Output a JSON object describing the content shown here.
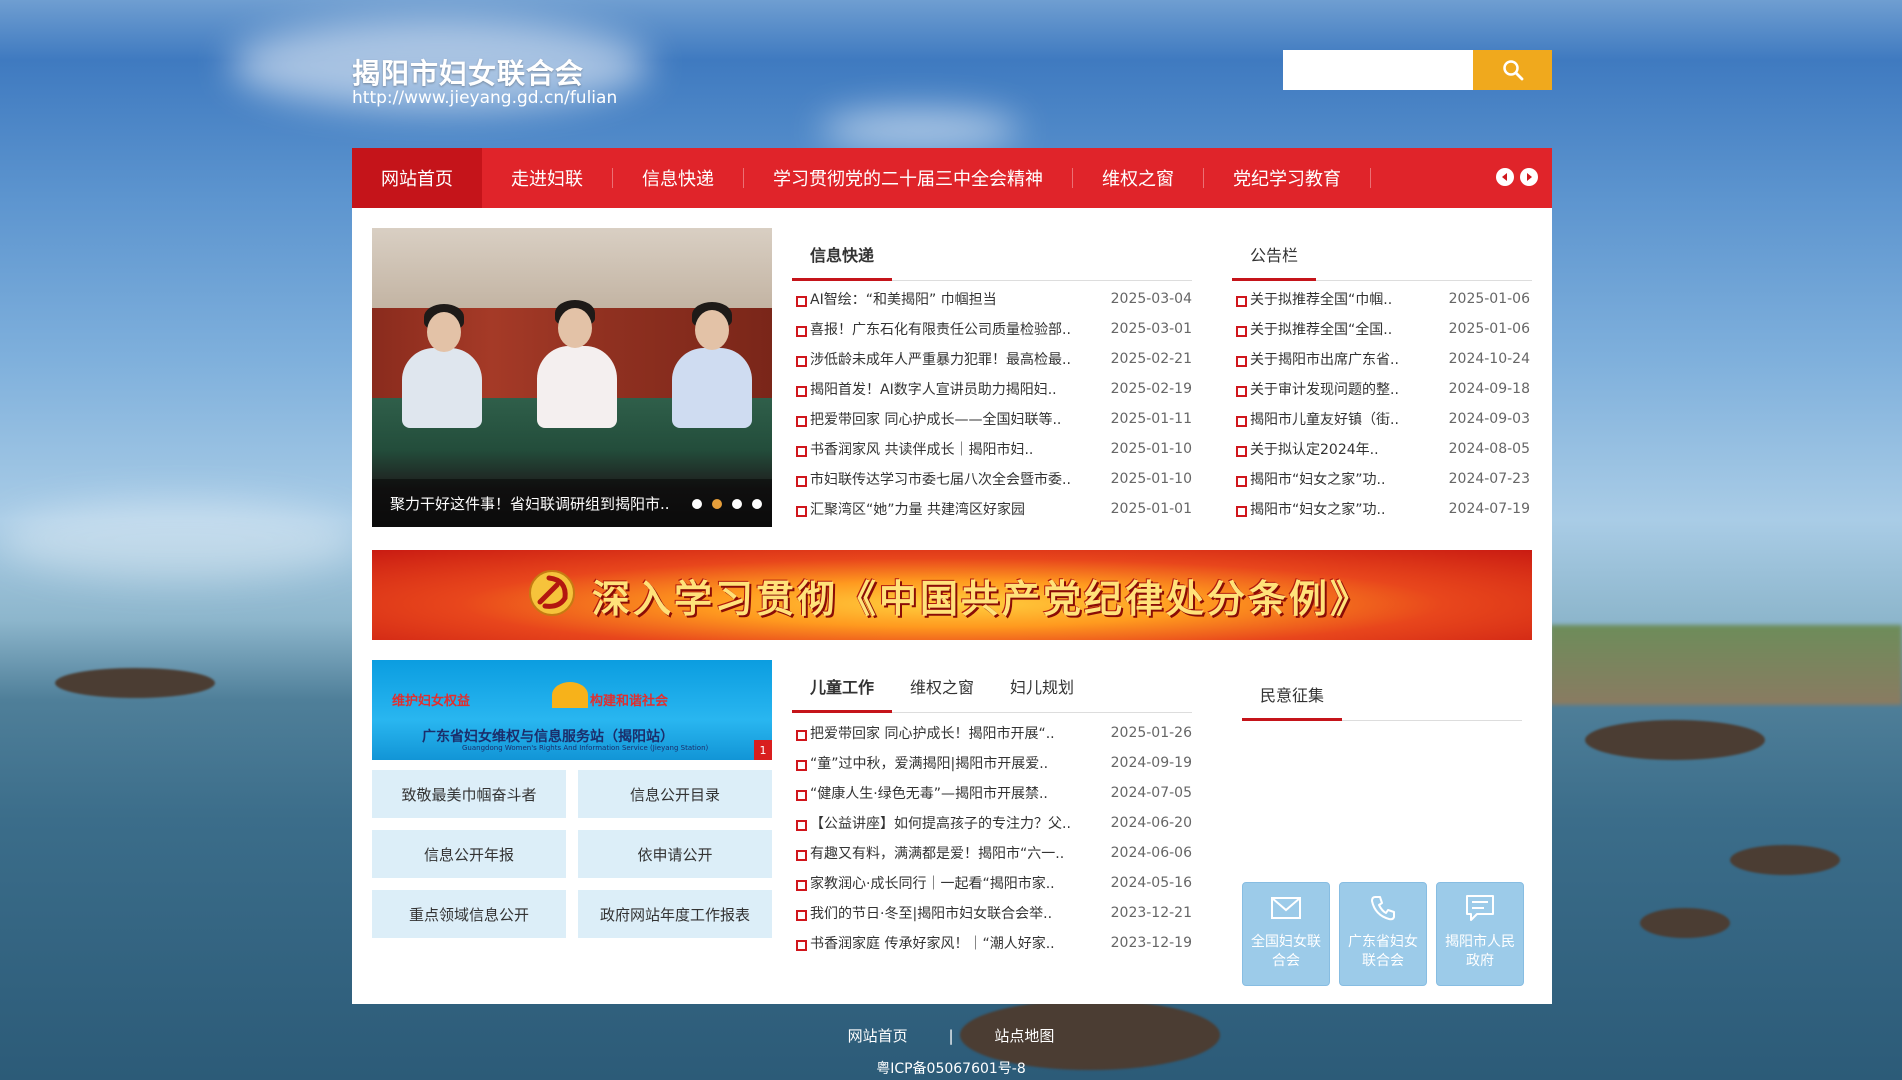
{
  "header": {
    "title": "揭阳市妇女联合会",
    "url": "http://www.jieyang.gd.cn/fulian",
    "search_placeholder": ""
  },
  "nav": {
    "items": [
      "网站首页",
      "走进妇联",
      "信息快递",
      "学习贯彻党的二十届三中全会精神",
      "维权之窗",
      "党纪学习教育"
    ]
  },
  "slideshow": {
    "caption": "聚力干好这件事！省妇联调研组到揭阳市..",
    "current_dot": 2,
    "dot_count": 4
  },
  "news": {
    "tab": "信息快递",
    "items": [
      {
        "title": "AI智绘：“和美揭阳” 巾帼担当",
        "date": "2025-03-04"
      },
      {
        "title": "喜报！广东石化有限责任公司质量检验部..",
        "date": "2025-03-01"
      },
      {
        "title": "涉低龄未成年人严重暴力犯罪！最高检最..",
        "date": "2025-02-21"
      },
      {
        "title": "揭阳首发！AI数字人宣讲员助力揭阳妇..",
        "date": "2025-02-19"
      },
      {
        "title": "把爱带回家 同心护成长——全国妇联等..",
        "date": "2025-01-11"
      },
      {
        "title": "书香润家风 共读伴成长｜揭阳市妇..",
        "date": "2025-01-10"
      },
      {
        "title": "市妇联传达学习市委七届八次全会暨市委..",
        "date": "2025-01-10"
      },
      {
        "title": "汇聚湾区“她”力量 共建湾区好家园",
        "date": "2025-01-01"
      }
    ]
  },
  "notice": {
    "tab": "公告栏",
    "items": [
      {
        "title": "关于拟推荐全国“巾帼..",
        "date": "2025-01-06"
      },
      {
        "title": "关于拟推荐全国“全国..",
        "date": "2025-01-06"
      },
      {
        "title": "关于揭阳市出席广东省..",
        "date": "2024-10-24"
      },
      {
        "title": "关于审计发现问题的整..",
        "date": "2024-09-18"
      },
      {
        "title": "揭阳市儿童友好镇（街..",
        "date": "2024-09-03"
      },
      {
        "title": "关于拟认定2024年..",
        "date": "2024-08-05"
      },
      {
        "title": "揭阳市“妇女之家”功..",
        "date": "2024-07-23"
      },
      {
        "title": "揭阳市“妇女之家”功..",
        "date": "2024-07-19"
      }
    ]
  },
  "banner": {
    "text": "深入学习贯彻《中国共产党纪律处分条例》"
  },
  "rights_banner": {
    "left_slogan": "维护妇女权益",
    "right_slogan": "构建和谐社会",
    "title": "广东省妇女维权与信息服务站（揭阳站）",
    "subtitle": "Guangdong Women's Rights And Information Service (Jieyang Station)",
    "badge": "1"
  },
  "grid_buttons": [
    "致敬最美巾帼奋斗者",
    "信息公开目录",
    "信息公开年报",
    "依申请公开",
    "重点领域信息公开",
    "政府网站年度工作报表"
  ],
  "child": {
    "tabs": [
      "儿童工作",
      "维权之窗",
      "妇儿规划"
    ],
    "items": [
      {
        "title": "把爱带回家 同心护成长！揭阳市开展“..",
        "date": "2025-01-26"
      },
      {
        "title": "“童”过中秋，爱满揭阳|揭阳市开展爱..",
        "date": "2024-09-19"
      },
      {
        "title": "“健康人生·绿色无毒”—揭阳市开展禁..",
        "date": "2024-07-05"
      },
      {
        "title": "【公益讲座】如何提高孩子的专注力？父..",
        "date": "2024-06-20"
      },
      {
        "title": "有趣又有料，满满都是爱！揭阳市“六一..",
        "date": "2024-06-06"
      },
      {
        "title": "家教润心·成长同行｜一起看“揭阳市家..",
        "date": "2024-05-16"
      },
      {
        "title": "我们的节日·冬至|揭阳市妇女联合会举..",
        "date": "2023-12-21"
      },
      {
        "title": "书香润家庭 传承好家风！｜“潮人好家..",
        "date": "2023-12-19"
      }
    ]
  },
  "opinion": {
    "tab": "民意征集"
  },
  "quick_links": [
    {
      "label": "全国妇女联合会",
      "icon": "mail-icon"
    },
    {
      "label": "广东省妇女联合会",
      "icon": "phone-icon"
    },
    {
      "label": "揭阳市人民政府",
      "icon": "message-icon"
    }
  ],
  "footer": {
    "links": [
      "网站首页",
      "|",
      "站点地图"
    ],
    "icp": "粤ICP备05067601号-8"
  },
  "colors": {
    "nav_red": "#e0242a",
    "nav_active": "#c5141a",
    "search_button": "#f0a91d",
    "quick_link_bg": "#9ccbe9"
  }
}
